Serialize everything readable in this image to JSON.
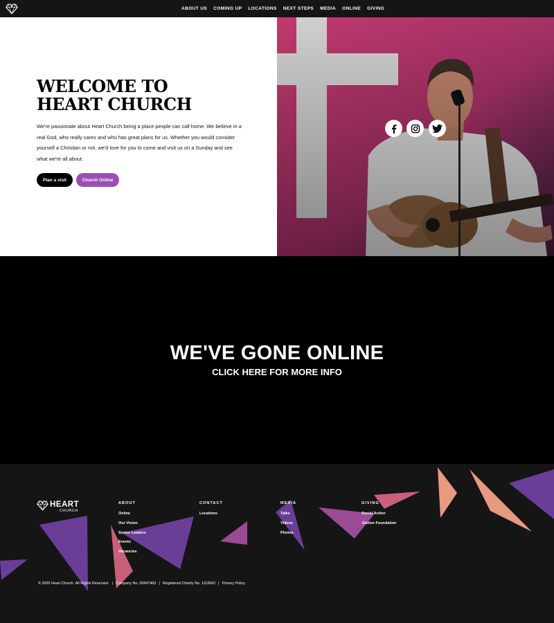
{
  "nav": {
    "items": [
      {
        "label": "ABOUT US"
      },
      {
        "label": "COMING UP"
      },
      {
        "label": "LOCATIONS"
      },
      {
        "label": "NEXT STEPS"
      },
      {
        "label": "MEDIA"
      },
      {
        "label": "ONLINE"
      },
      {
        "label": "GIVING"
      }
    ]
  },
  "hero": {
    "title_line1": "WELCOME TO",
    "title_line2": "HEART CHURCH",
    "text": "We're passionate about Heart Church being a place people can call home. We believe in a real God, who really cares and who has great plans for us. Whether you would consider yourself a Christian or not, we'd love for you to come and visit us on a Sunday and see what we're all about.",
    "btn_visit": "Plan a visit",
    "btn_online": "Church Online",
    "social_icons": [
      "facebook-icon",
      "instagram-icon",
      "twitter-icon"
    ]
  },
  "banner": {
    "title": "WE'VE GONE ONLINE",
    "subtitle": "CLICK HERE FOR MORE INFO"
  },
  "footer": {
    "brand": "HEART",
    "brand_sub": "CHURCH",
    "columns": [
      {
        "heading": "ABOUT",
        "links": [
          "Online",
          "Our Vision",
          "Senior Leaders",
          "Events",
          "Vacancies"
        ]
      },
      {
        "heading": "CONTACT",
        "links": [
          "Locations"
        ]
      },
      {
        "heading": "MEDIA",
        "links": [
          "Talks",
          "Videos",
          "Photos"
        ]
      },
      {
        "heading": "GIVING",
        "links": [
          "Social Action",
          "Jubilee Foundation"
        ]
      }
    ],
    "copyright": "© 2020 Heart Church. All Rights Reserved.",
    "company": "Company No. 05947463",
    "charity": "Registered Charity No. 1119562",
    "privacy": "Privacy Policy"
  },
  "colors": {
    "accent_purple": "#9b4fb5",
    "nav_bg": "#151515",
    "triangle_purple": "#6a3d96",
    "triangle_pink": "#c8607a",
    "triangle_peach": "#e89a80"
  }
}
